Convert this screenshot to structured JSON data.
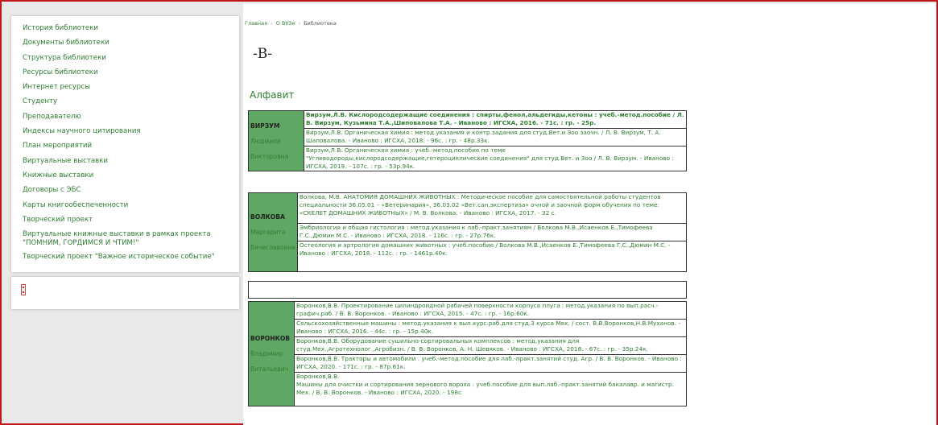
{
  "sidebar": {
    "items": [
      "История библиотеки",
      "Документы библиотеки",
      "Структура библиотеки",
      "Ресурсы библиотеки",
      "Интернет ресурсы",
      "Студенту",
      "Преподавателю",
      "Индексы научного цитирования",
      "План мероприятий",
      "Виртуальные выставки",
      "Книжные выставки",
      "Договоры с ЭБС",
      "Карты книгообеспеченности",
      "Творческий проект",
      "Виртуальные книжные выставки в рамках проекта \"ПОМНИМ, ГОРДИМСЯ И ЧТИМ!\"",
      "Творческий проект \"Важное историческое событие\""
    ]
  },
  "breadcrumb": {
    "home": "Главная",
    "section": "О ВУЗе",
    "current": "Библиотека"
  },
  "page": {
    "letter": "-В-",
    "alphabet_title": "Алфавит"
  },
  "authors": [
    {
      "surname": "ВИРЗУМ",
      "first": "Людмила",
      "patronymic": "Викторовна",
      "books": [
        "Вирзум,Л.В.  Кислородсодержащие соединения : спирты,фенол,альдегиды,кетоны : учеб.-метод.пособие / Л. В. Вирзум, Кузьмина Т.А.,Шиповалова Т.А. - Иваново : ИГСХА, 2016. - 71с. : гр. - 25р.",
        "Вирзум,Л.В.  Органическая химия : метод.указания и контр.задания для студ.Вет.и Зоо заочн. / Л. В. Вирзум, Т. А. Шаповалова. - Иваново : ИГСХА, 2018. - 96с. : гр. - 48р.33к.",
        "Вирзум,Л.В.  Органическая химия : учеб.-метод.пособие по теме \"Углеводороды,кислородсодержащие,гетероциклические соединения\" для студ.Вет. и Зоо / Л. В. Вирзум. - Иваново : ИГСХА, 2019. - 107с. : гр. - 53р.94к."
      ]
    },
    {
      "surname": "ВОЛКОВА",
      "first": "Маргарита",
      "patronymic": "Вячеславовна",
      "books": [
        "Волкова, М.В.  АНАТОМИЯ ДОМАШНИХ ЖИВОТНЫХ : Методическое пособие для самостоятельной работы студентов специальности 36.05.01 – «Ветеринария», 36.03.02 «Вет.сан.экспертиза» очной и заочной форм обучения по теме: «СКЕЛЕТ ДОМАШНИХ ЖИВОТНЫХ» / М. В. Волкова. - Иваново : ИГСХА, 2017. - 32 с.",
        "Эмбриология и общая гистология : метод.указания к лаб.-практ.занятиям / Волкова М.В.,Исаенков Е.,Тимофеева Г.С.,Дюмин М.С. - Иваново : ИГСХА, 2018. - 116с. : гр. - 27р.76к.",
        "Остеология и артрология домашних животных : учеб.пособие / Волкова М.В.,Исаенков Е.,Тимофеева Г.С.,Дюмин М.С. - Иваново : ИГСХА, 2018. - 112с. : гр. - 1461р.40к."
      ]
    },
    {
      "surname": "ВОРОНКОВ",
      "first": "Владимир",
      "patronymic": "Витальевич",
      "books": [
        "Воронков,В.В.  Проектирование цилиндроидной рабачей поверхности корпуса плуга : метод.указания по вып.расч.-графич.раб. / В. В. Воронков. - Иваново : ИГСХА, 2015. - 47с. : гр. - 16р.60к.",
        "Сельскохозяйственные машины : метод.указания к вып.курс.раб.для студ.3 курса Мех. / сост. В.В.Воронков,Н.В.Муханов. - Иваново : ИГСХА, 2016. - 44с. : гр. - 15р.40к.",
        "Воронков,В.В.  Оборудование сушильно-сортировальных комплексов : метод.указания для студ.Мех.,Агротехнолог.,Агробизн. / В. В. Воронков, А. Н. Шевяков. - Иваново : ИГСХА, 2018. - 67с. : гр. - 35р.24к.",
        "Воронков,В.В.  Тракторы и автомобили : учеб.-метод.пособие для лаб.-практ.занятий студ. Агр. / В. В. Воронков. - Иваново : ИГСХА, 2020. - 171с. : гр. - 87р.61к.",
        "Воронков,В.В.",
        "Машины для очистки и сортирования зернового вороха : учеб.пособие для вып.лаб.-практ.занятий бакалавр. и магистр. Мех. / В. В. Воронков. - Иваново : ИГСХА, 2020. - 198с"
      ]
    }
  ],
  "colors": {
    "link": "#2f7d32",
    "accent_border": "#c0171d",
    "author_bar": "#5fa864"
  }
}
